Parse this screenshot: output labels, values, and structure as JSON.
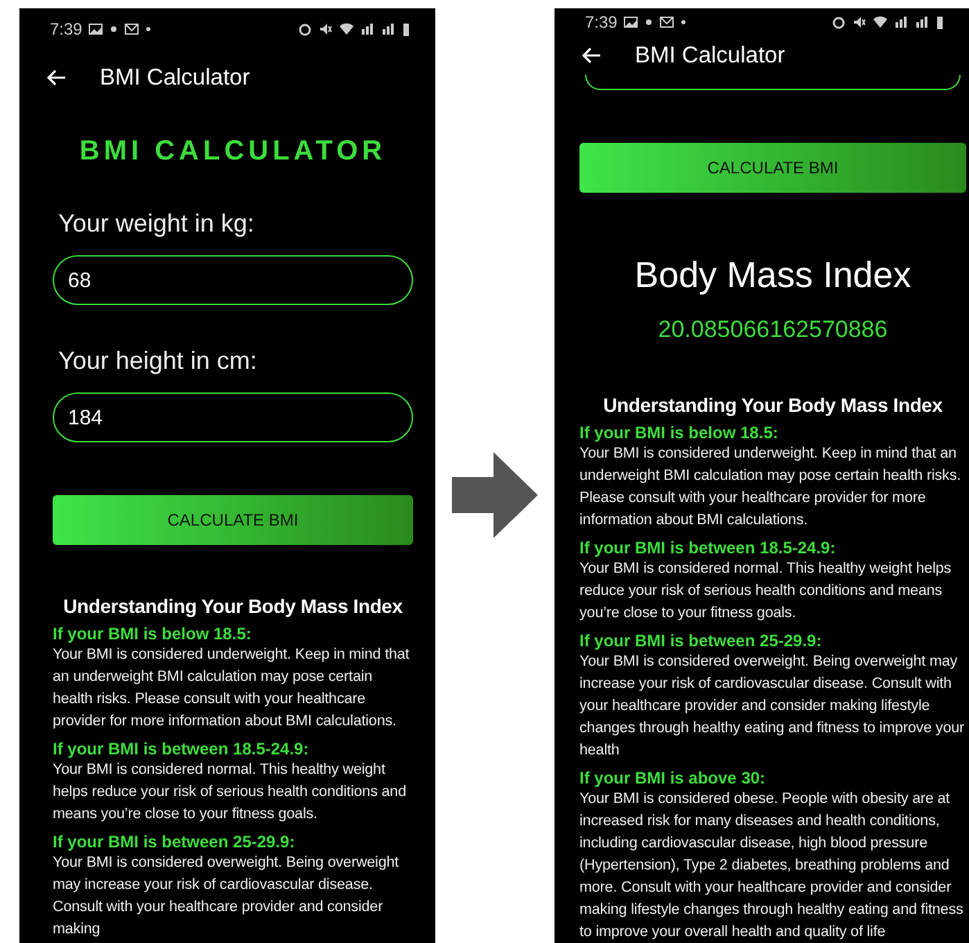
{
  "screens": [
    {
      "status_bar": {
        "time": "7:39"
      },
      "app_bar": {
        "title": "BMI Calculator"
      },
      "content": [
        {
          "kind": "logo",
          "text": "BMI CALCULATOR"
        },
        {
          "kind": "field",
          "label": "Your weight in kg:",
          "value": "68"
        },
        {
          "kind": "field",
          "label": "Your height in cm:",
          "value": "184"
        },
        {
          "kind": "button",
          "text": "CALCULATE BMI"
        },
        {
          "kind": "info_title",
          "text": "Understanding Your Body Mass Index"
        },
        {
          "kind": "info_section",
          "heading": "If your BMI is below 18.5:",
          "body": "Your BMI is considered underweight. Keep in mind that an underweight BMI calculation may pose certain health risks. Please consult with your healthcare provider for more information about BMI calculations."
        },
        {
          "kind": "info_section",
          "heading": "If your BMI is between 18.5-24.9:",
          "body": "Your BMI is considered normal. This healthy weight helps reduce your risk of serious health conditions and means you’re close to your fitness goals."
        },
        {
          "kind": "info_section",
          "heading": "If your BMI is between 25-29.9:",
          "body": "Your BMI is considered overweight. Being overweight may increase your risk of cardiovascular disease. Consult with your healthcare provider and consider making"
        }
      ]
    },
    {
      "status_bar": {
        "time": "7:39"
      },
      "app_bar": {
        "title": "BMI Calculator"
      },
      "content": [
        {
          "kind": "field_edge"
        },
        {
          "kind": "button",
          "text": "CALCULATE BMI"
        },
        {
          "kind": "result_title",
          "text": "Body Mass Index"
        },
        {
          "kind": "result_value",
          "text": "20.085066162570886"
        },
        {
          "kind": "info_title",
          "text": "Understanding Your Body Mass Index"
        },
        {
          "kind": "info_section",
          "heading": "If your BMI is below 18.5:",
          "body": "Your BMI is considered underweight. Keep in mind that an underweight BMI calculation may pose certain health risks. Please consult with your healthcare provider for more information about BMI calculations."
        },
        {
          "kind": "info_section",
          "heading": "If your BMI is between 18.5-24.9:",
          "body": "Your BMI is considered normal. This healthy weight helps reduce your risk of serious health conditions and means you’re close to your fitness goals."
        },
        {
          "kind": "info_section",
          "heading": "If your BMI is between 25-29.9:",
          "body": "Your BMI is considered overweight. Being overweight may increase your risk of cardiovascular disease. Consult with your healthcare provider and consider making lifestyle changes through healthy eating and fitness to improve your health"
        },
        {
          "kind": "info_section",
          "heading": "If your BMI is above 30:",
          "body": "Your BMI is considered obese. People with obesity are at increased risk for many diseases and health conditions, including cardiovascular disease, high blood pressure (Hypertension), Type 2 diabetes, breathing problems and more. Consult with your healthcare provider and consider making lifestyle changes through healthy eating and fitness to improve your overall health and quality of life"
        }
      ]
    }
  ]
}
